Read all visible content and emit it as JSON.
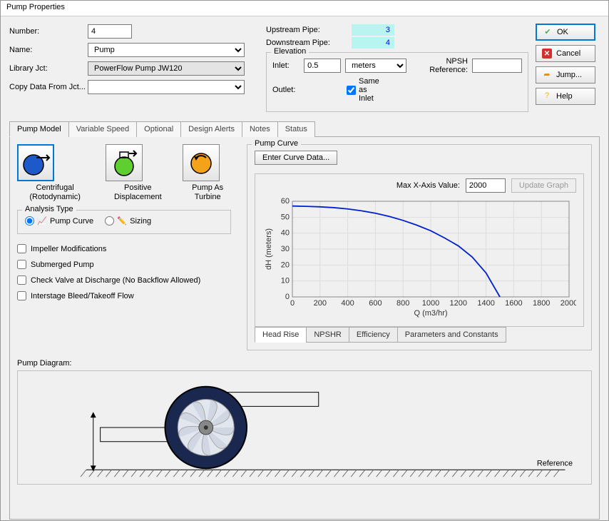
{
  "window": {
    "title": "Pump Properties"
  },
  "buttons": {
    "ok": "OK",
    "cancel": "Cancel",
    "jump": "Jump...",
    "help": "Help"
  },
  "fields": {
    "number_label": "Number:",
    "number_value": "4",
    "name_label": "Name:",
    "name_value": "Pump",
    "library_label": "Library Jct:",
    "library_value": "PowerFlow Pump JW120",
    "copy_label": "Copy Data From Jct..."
  },
  "pipes": {
    "upstream_label": "Upstream Pipe:",
    "upstream_value": "3",
    "downstream_label": "Downstream Pipe:",
    "downstream_value": "4"
  },
  "elev": {
    "group": "Elevation",
    "inlet_label": "Inlet:",
    "inlet_value": "0.5",
    "units": "meters",
    "outlet_label": "Outlet:",
    "same_as_inlet": "Same as Inlet",
    "npsh_label": "NPSH Reference:"
  },
  "tabs": [
    "Pump Model",
    "Variable Speed",
    "Optional",
    "Design Alerts",
    "Notes",
    "Status"
  ],
  "models": {
    "centrifugal": "Centrifugal (Rotodynamic)",
    "positive": "Positive Displacement",
    "turbine": "Pump As Turbine"
  },
  "analysis": {
    "group": "Analysis Type",
    "pump_curve": "Pump Curve",
    "sizing": "Sizing"
  },
  "checks": {
    "impeller": "Impeller Modifications",
    "submerged": "Submerged Pump",
    "checkvalve": "Check Valve at Discharge (No Backflow Allowed)",
    "interstage": "Interstage Bleed/Takeoff Flow"
  },
  "curve": {
    "group": "Pump Curve",
    "enter": "Enter Curve Data...",
    "maxx_label": "Max X-Axis Value:",
    "maxx_value": "2000",
    "update": "Update Graph",
    "tabs": [
      "Head Rise",
      "NPSHR",
      "Efficiency",
      "Parameters and Constants"
    ]
  },
  "diagram": {
    "label": "Pump Diagram:",
    "reference": "Reference"
  },
  "chart_data": {
    "type": "line",
    "title": "",
    "xlabel": "Q (m3/hr)",
    "ylabel": "dH (meters)",
    "xlim": [
      0,
      2000
    ],
    "ylim": [
      0,
      60
    ],
    "xticks": [
      0,
      200,
      400,
      600,
      800,
      1000,
      1200,
      1400,
      1600,
      1800,
      2000
    ],
    "yticks": [
      0,
      10,
      20,
      30,
      40,
      50,
      60
    ],
    "series": [
      {
        "name": "Head Rise",
        "x": [
          0,
          100,
          200,
          300,
          400,
          500,
          600,
          700,
          800,
          900,
          1000,
          1100,
          1200,
          1300,
          1400,
          1500
        ],
        "y": [
          57,
          56.8,
          56.5,
          56,
          55.2,
          54,
          52.5,
          50.5,
          48,
          45,
          41.5,
          37,
          32,
          25,
          15,
          0
        ]
      }
    ]
  }
}
